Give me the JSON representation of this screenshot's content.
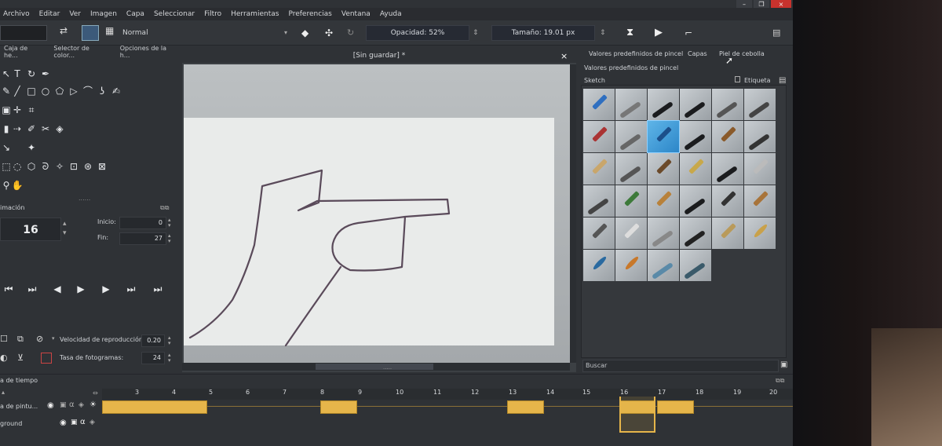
{
  "window": {
    "unsaved_title": "[Sin guardar]",
    "modified_mark": "*",
    "close": "×",
    "minimize": "–",
    "maximize": "❐"
  },
  "menu": [
    "Archivo",
    "Editar",
    "Ver",
    "Imagen",
    "Capa",
    "Seleccionar",
    "Filtro",
    "Herramientas",
    "Preferencias",
    "Ventana",
    "Ayuda"
  ],
  "toolbar": {
    "blend_mode": "Normal",
    "opacity_label": "Opacidad: 52%",
    "size_label": "Tamaño: 19.01 px"
  },
  "left_tabs": [
    "Caja de he...",
    "Selector de color...",
    "Opciones de la h..."
  ],
  "animation": {
    "title": "imación",
    "frame": "16",
    "start_label": "Inicio:",
    "start_value": "0",
    "end_label": "Fin:",
    "end_value": "27",
    "speed_label": "Velocidad de reproducción:",
    "speed_value": "0.20",
    "fps_label": "Tasa de fotogramas:",
    "fps_value": "24"
  },
  "right_docker": {
    "tabs": [
      "Valores predefinidos de pincel",
      "Capas",
      "Piel de cebolla"
    ],
    "header": "Valores predefinidos de pincel",
    "preset_set": "Sketch",
    "tag_label": "Etiqueta",
    "search": "Buscar"
  },
  "timeline": {
    "title": "a de tiempo",
    "frames": [
      "3",
      "4",
      "5",
      "6",
      "7",
      "8",
      "9",
      "10",
      "11",
      "12",
      "13",
      "14",
      "15",
      "16",
      "17",
      "18",
      "19",
      "20"
    ],
    "layers": [
      "a de pintu...",
      "ground"
    ],
    "current_frame": 16
  },
  "colors": {
    "accent": "#e6b54a",
    "selected_brush": "#3a9be0",
    "close": "#c8322d"
  }
}
